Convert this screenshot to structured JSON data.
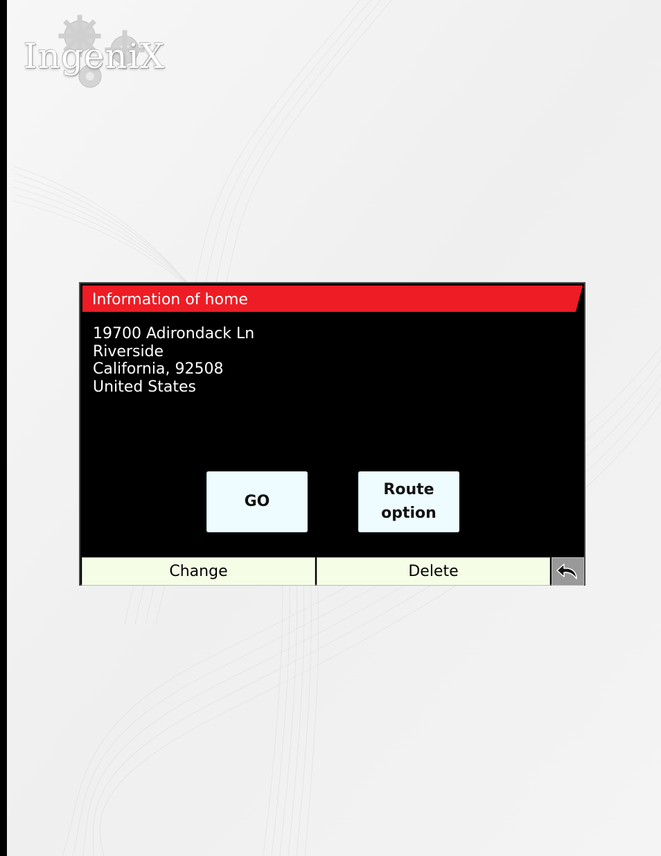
{
  "brand": {
    "logo_text": "IngeniX"
  },
  "dialog": {
    "title": "Information of home",
    "address": {
      "line1": "19700 Adirondack Ln",
      "line2": "Riverside",
      "line3": "California, 92508",
      "line4": "United States"
    },
    "buttons": {
      "go": "GO",
      "route_line1": "Route",
      "route_line2": "option"
    },
    "toolbar": {
      "change": "Change",
      "delete": "Delete",
      "back_icon": "undo-arrow-icon"
    }
  },
  "colors": {
    "title_bar": "#ee1c25",
    "action_button": "#eefcff",
    "toolbar_button": "#f5fde6",
    "back_button": "#999999"
  }
}
